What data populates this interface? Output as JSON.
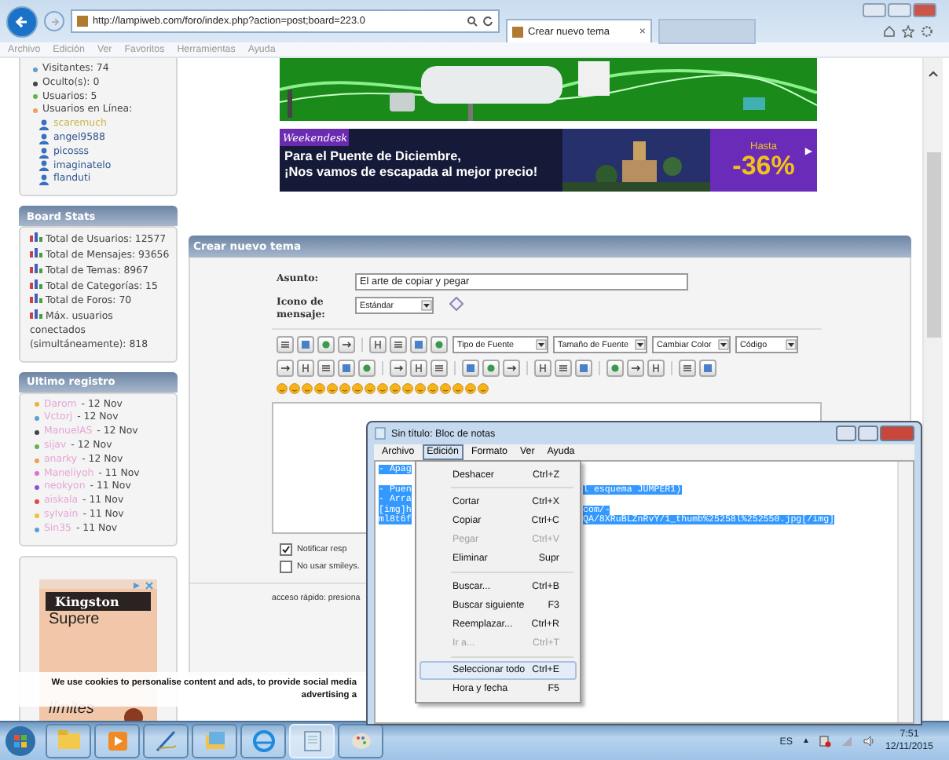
{
  "browser": {
    "address": "http://lampiweb.com/foro/index.php?action=post;board=223.0",
    "tabs": [
      {
        "label": "Crear nuevo tema",
        "selected": true
      }
    ],
    "tab_close": "×",
    "menu": [
      "Archivo",
      "Edición",
      "Ver",
      "Favoritos",
      "Herramientas",
      "Ayuda"
    ]
  },
  "sidebar": {
    "online_stats": [
      {
        "label": "Visitantes: 74",
        "color": "#5aa0d8"
      },
      {
        "label": "Oculto(s): 0",
        "color": "#444444"
      },
      {
        "label": "Usuarios: 5",
        "color": "#6ab04c"
      },
      {
        "label": "Usuarios en Línea:",
        "color": "#f0a050"
      }
    ],
    "online_users": [
      {
        "name": "scaremuch",
        "color": "#c9b54a"
      },
      {
        "name": "angel9588",
        "color": "#2f5590"
      },
      {
        "name": "picosss",
        "color": "#2f5590"
      },
      {
        "name": "imaginatelo",
        "color": "#2f5590"
      },
      {
        "name": "flanduti",
        "color": "#2f5590"
      }
    ],
    "board_stats": {
      "title": "Board Stats",
      "items": [
        "Total de Usuarios: 12577",
        "Total de Mensajes: 93656",
        "Total de Temas: 8967",
        "Total de Categorías: 15",
        "Total de Foros: 70",
        "Máx. usuarios conectados (simultáneamente): 818"
      ]
    },
    "latest": {
      "title": "Ultimo registro",
      "items": [
        {
          "name": "Darom",
          "date": "- 12 Nov",
          "color": "#f0b040"
        },
        {
          "name": "Vctorj",
          "date": "- 12 Nov",
          "color": "#5aa0d8"
        },
        {
          "name": "ManuelAS",
          "date": "- 12 Nov",
          "color": "#444444"
        },
        {
          "name": "sijav",
          "date": "- 12 Nov",
          "color": "#6ab04c"
        },
        {
          "name": "anarky",
          "date": "- 12 Nov",
          "color": "#f0a050"
        },
        {
          "name": "Maneliyoh",
          "date": "- 11 Nov",
          "color": "#e070d0"
        },
        {
          "name": "neokyon",
          "date": "- 11 Nov",
          "color": "#9050e0"
        },
        {
          "name": "aiskala",
          "date": "- 11 Nov",
          "color": "#e04848"
        },
        {
          "name": "sylvain",
          "date": "- 11 Nov",
          "color": "#f0c040"
        },
        {
          "name": "Sin35",
          "date": "- 11 Nov",
          "color": "#5aa0d8"
        }
      ]
    },
    "ad": {
      "brand": "Kingston",
      "lines": [
        "Supere",
        "límites"
      ]
    }
  },
  "banner": {
    "logo": "Weekendesk",
    "headline": [
      "Para el Puente de Diciembre,",
      "¡Nos vamos de escapada al mejor precio!"
    ],
    "offer_label": "Hasta",
    "offer": "-36%",
    "arrow": "▶"
  },
  "post_form": {
    "title": "Crear nuevo tema",
    "subject_label": "Asunto:",
    "subject": "El arte de copiar y pegar",
    "icon_label": "Icono de mensaje:",
    "icon_value": "Estándar",
    "selects": [
      "Tipo de Fuente",
      "Tamaño de Fuente",
      "Cambiar Color",
      "Código"
    ],
    "options": [
      {
        "label": "Notificar resp",
        "checked": true
      },
      {
        "label": "No usar smileys.",
        "checked": false
      }
    ],
    "quick_access": "acceso rápido: presiona"
  },
  "cookie_notice": [
    "We use cookies to personalise content and ads, to provide social media",
    "advertising a"
  ],
  "notepad": {
    "title": "Sin título: Bloc de notas",
    "text_selected": true,
    "menu": [
      {
        "label": "Archivo",
        "selected": false
      },
      {
        "label": "Edición",
        "selected": true
      },
      {
        "label": "Formato",
        "selected": false
      },
      {
        "label": "Ver",
        "selected": false
      },
      {
        "label": "Ayuda",
        "selected": false
      }
    ],
    "lines": [
      {
        "left": "- Apag"
      },
      {
        "left": "- Puen",
        "right": "l esquema JUMPER1)"
      },
      {
        "left": "- Arra"
      },
      {
        "left": "[img]h",
        "right": "com/-"
      },
      {
        "left": "ml8t6f",
        "right": "QA/8XRuBLZnRvY/1_thumb%25258l%252550.jpg[/img]"
      }
    ],
    "edit_menu": [
      [
        {
          "label": "Deshacer",
          "shortcut": "Ctrl+Z",
          "disabled": false,
          "selected": false
        }
      ],
      [
        {
          "label": "Cortar",
          "shortcut": "Ctrl+X",
          "disabled": false,
          "selected": false
        },
        {
          "label": "Copiar",
          "shortcut": "Ctrl+C",
          "disabled": false,
          "selected": false
        },
        {
          "label": "Pegar",
          "shortcut": "Ctrl+V",
          "disabled": true,
          "selected": false
        },
        {
          "label": "Eliminar",
          "shortcut": "Supr",
          "disabled": false,
          "selected": false
        }
      ],
      [
        {
          "label": "Buscar...",
          "shortcut": "Ctrl+B",
          "disabled": false,
          "selected": false
        },
        {
          "label": "Buscar siguiente",
          "shortcut": "F3",
          "disabled": false,
          "selected": false
        },
        {
          "label": "Reemplazar...",
          "shortcut": "Ctrl+R",
          "disabled": false,
          "selected": false
        },
        {
          "label": "Ir a...",
          "shortcut": "Ctrl+T",
          "disabled": true,
          "selected": false
        }
      ],
      [
        {
          "label": "Seleccionar todo",
          "shortcut": "Ctrl+E",
          "disabled": false,
          "selected": true
        },
        {
          "label": "Hora y fecha",
          "shortcut": "F5",
          "disabled": false,
          "selected": false
        }
      ]
    ]
  },
  "taskbar": {
    "apps": [
      {
        "selected": false
      },
      {
        "selected": false
      },
      {
        "selected": false
      },
      {
        "selected": false
      },
      {
        "selected": false
      },
      {
        "selected": true
      },
      {
        "selected": false
      }
    ],
    "language": "ES",
    "tray_arrow": "▲",
    "time": "7:51",
    "date": "12/11/2015"
  }
}
